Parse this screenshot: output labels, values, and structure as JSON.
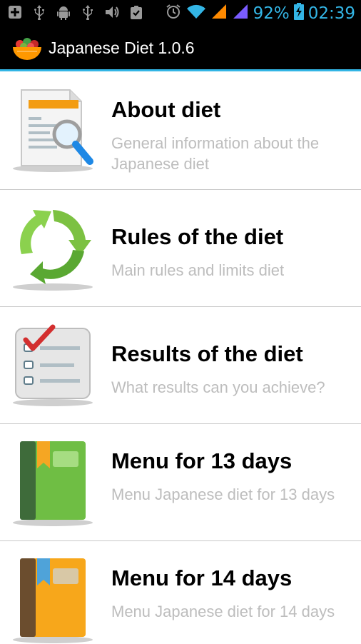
{
  "status_bar": {
    "battery": "92%",
    "time": "02:39"
  },
  "action_bar": {
    "title": "Japanese Diet 1.0.6"
  },
  "items": [
    {
      "title": "About diet",
      "subtitle": "General information about the Japanese diet",
      "icon": "document-magnifier-icon"
    },
    {
      "title": "Rules of the diet",
      "subtitle": "Main rules and limits diet",
      "icon": "green-recycle-arrows-icon"
    },
    {
      "title": "Results of the diet",
      "subtitle": "What results can you achieve?",
      "icon": "checklist-icon"
    },
    {
      "title": "Menu for 13 days",
      "subtitle": "Menu Japanese diet for 13 days",
      "icon": "green-book-icon"
    },
    {
      "title": "Menu for 14 days",
      "subtitle": "Menu Japanese diet for 14 days",
      "icon": "orange-book-icon"
    }
  ],
  "colors": {
    "accent": "#33b5e5",
    "subtitle": "#bdbdbd",
    "divider": "#c8c8c8"
  }
}
